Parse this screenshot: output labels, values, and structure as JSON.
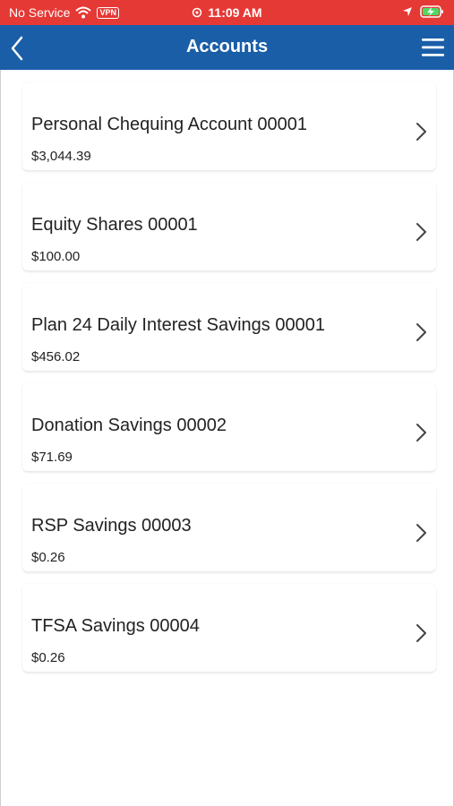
{
  "status_bar": {
    "carrier": "No Service",
    "vpn": "VPN",
    "time": "11:09 AM",
    "background": "#e53935"
  },
  "header": {
    "title": "Accounts",
    "background": "#1a5ea8"
  },
  "icons": {
    "back": "chevron-left-icon",
    "menu": "hamburger-menu-icon",
    "row_chevron": "chevron-right-icon"
  },
  "accounts": [
    {
      "name": "Personal Chequing Account 00001",
      "balance": "$3,044.39"
    },
    {
      "name": "Equity Shares 00001",
      "balance": "$100.00"
    },
    {
      "name": "Plan 24 Daily Interest Savings 00001",
      "balance": "$456.02"
    },
    {
      "name": "Donation Savings 00002",
      "balance": "$71.69"
    },
    {
      "name": "RSP Savings 00003",
      "balance": "$0.26"
    },
    {
      "name": "TFSA Savings 00004",
      "balance": "$0.26"
    }
  ]
}
